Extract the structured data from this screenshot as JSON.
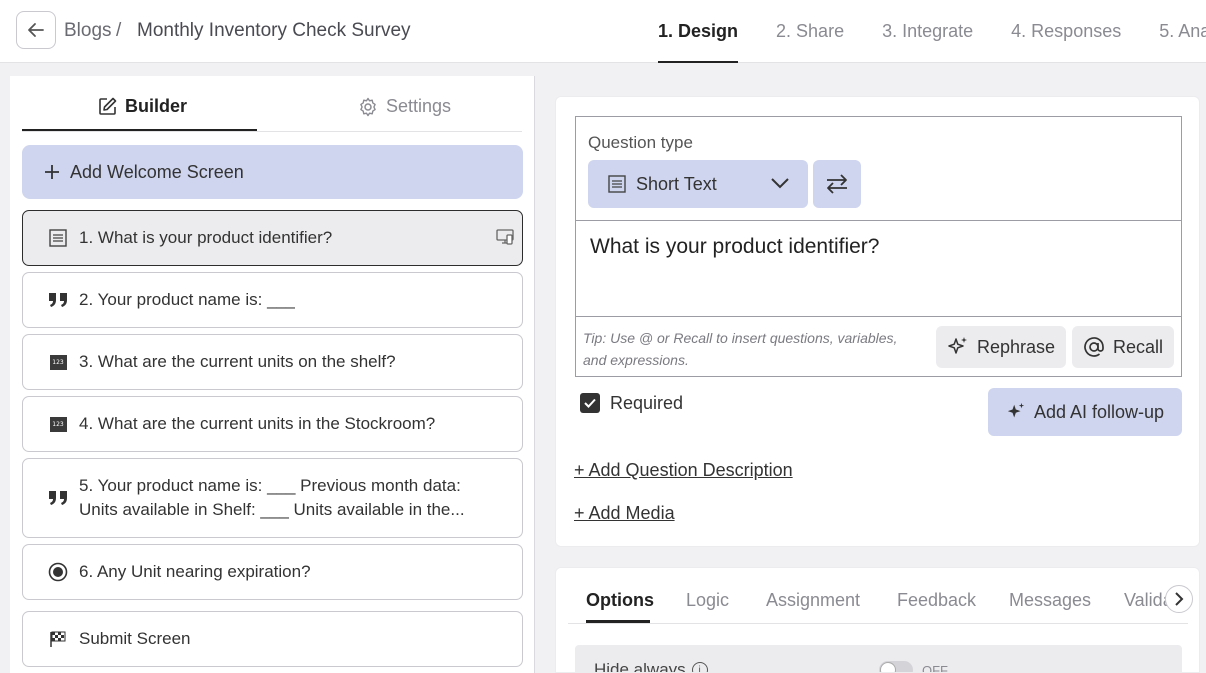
{
  "header": {
    "breadcrumb_root": "Blogs",
    "breadcrumb_sep": "/",
    "survey_title": "Monthly Inventory Check Survey",
    "steps": [
      {
        "label": "1. Design",
        "active": true
      },
      {
        "label": "2. Share"
      },
      {
        "label": "3. Integrate"
      },
      {
        "label": "4. Responses"
      },
      {
        "label": "5. Ana"
      }
    ]
  },
  "builder": {
    "tabs": {
      "builder": "Builder",
      "settings": "Settings"
    },
    "welcome_label": "Add Welcome Screen",
    "questions": [
      {
        "label": "1. What is your product identifier?",
        "icon": "short-text-icon",
        "selected": true
      },
      {
        "label": "2. Your product name is: ___",
        "icon": "quote-icon"
      },
      {
        "label": "3. What are the current units on the shelf?",
        "icon": "number-icon",
        "icon_text": "123"
      },
      {
        "label": "4. What are the current units in the Stockroom?",
        "icon": "number-icon",
        "icon_text": "123"
      },
      {
        "label": "5. Your product name is: ___   Previous month data: Units available in Shelf: ___   Units available in the...",
        "icon": "quote-icon"
      },
      {
        "label": "6. Any Unit nearing expiration?",
        "icon": "radio-icon"
      },
      {
        "label": "Submit Screen",
        "icon": "checkered-flag-icon"
      }
    ]
  },
  "editor": {
    "question_type_label": "Question type",
    "question_type_value": "Short Text",
    "question_title": "What is your product identifier?",
    "tip": "Tip: Use @ or Recall to insert questions, variables, and expressions.",
    "rephrase_label": "Rephrase",
    "recall_label": "Recall",
    "required_label": "Required",
    "required_checked": true,
    "ai_followup_label": "Add AI follow-up",
    "add_description_label": "+ Add Question Description",
    "add_media_label": "+ Add Media"
  },
  "options": {
    "tabs": [
      "Options",
      "Logic",
      "Assignment",
      "Feedback",
      "Messages",
      "Valida"
    ],
    "active_tab": "Options",
    "hide_always_label": "Hide always",
    "hide_always_state": "OFF"
  },
  "colors": {
    "accent_light": "#cfd5ee",
    "text_dark": "#222222",
    "muted": "#8a8a92"
  }
}
